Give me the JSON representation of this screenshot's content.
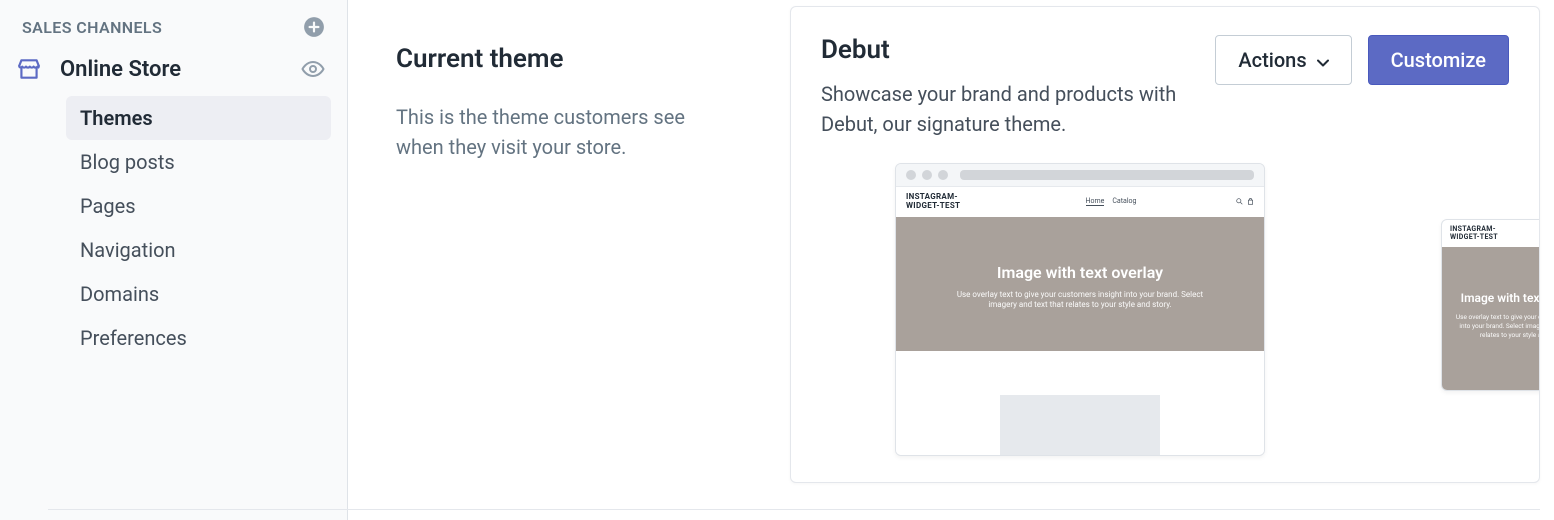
{
  "sidebar": {
    "section_label": "SALES CHANNELS",
    "channel_label": "Online Store",
    "items": [
      {
        "label": "Themes"
      },
      {
        "label": "Blog posts"
      },
      {
        "label": "Pages"
      },
      {
        "label": "Navigation"
      },
      {
        "label": "Domains"
      },
      {
        "label": "Preferences"
      }
    ]
  },
  "left": {
    "heading": "Current theme",
    "description": "This is the theme customers see when they visit your store."
  },
  "theme": {
    "name": "Debut",
    "description": "Showcase your brand and products with Debut, our signature theme.",
    "actions_label": "Actions",
    "customize_label": "Customize"
  },
  "preview": {
    "site_name": "INSTAGRAM-WIDGET-TEST",
    "nav": [
      "Home",
      "Catalog"
    ],
    "hero_title": "Image with text overlay",
    "hero_text": "Use overlay text to give your customers insight into your brand. Select imagery and text that relates to your style and story."
  }
}
